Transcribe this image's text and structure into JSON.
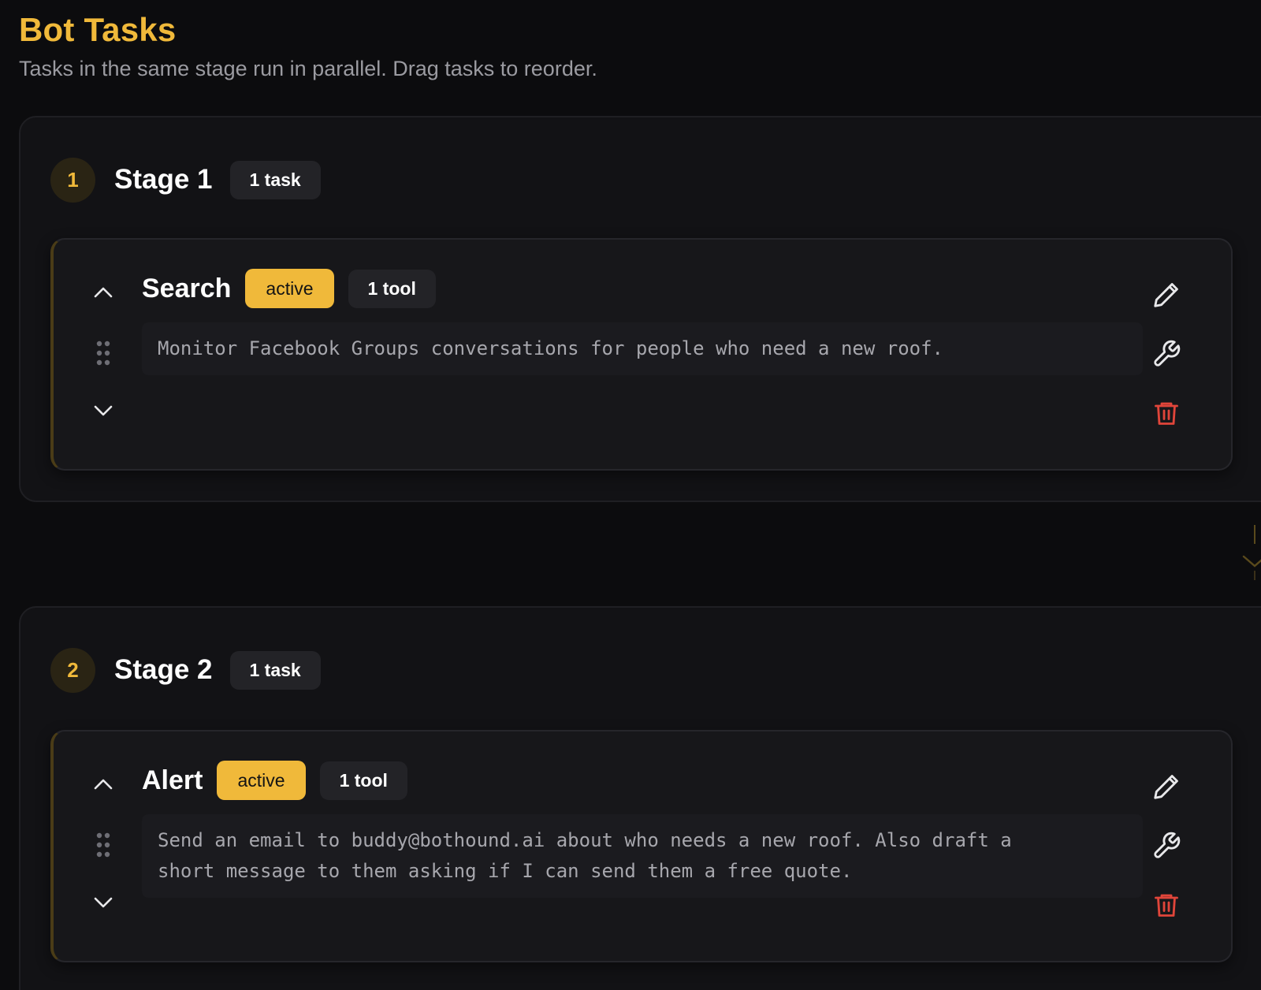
{
  "page": {
    "title": "Bot Tasks",
    "subtitle": "Tasks in the same stage run in parallel. Drag tasks to reorder."
  },
  "colors": {
    "accent": "#f0b93a",
    "background": "#0c0c0e",
    "danger": "#e0453a"
  },
  "stages": [
    {
      "number": "1",
      "title": "Stage 1",
      "task_count": "1 task",
      "tasks": [
        {
          "title": "Search",
          "status": "active",
          "tool_count": "1 tool",
          "description": "Monitor Facebook Groups conversations for people who need a new roof."
        }
      ]
    },
    {
      "number": "2",
      "title": "Stage 2",
      "task_count": "1 task",
      "tasks": [
        {
          "title": "Alert",
          "status": "active",
          "tool_count": "1 tool",
          "description": "Send an email to buddy@bothound.ai about who needs a new roof. Also draft a\nshort message to them asking if I can send them a free quote."
        }
      ]
    }
  ],
  "icons": {
    "collapse": "chevron-up-icon",
    "expand": "chevron-down-icon",
    "drag": "drag-handle-icon",
    "edit": "pencil-icon",
    "tools": "wrench-icon",
    "delete": "trash-icon",
    "connector": "arrow-down-icon"
  }
}
